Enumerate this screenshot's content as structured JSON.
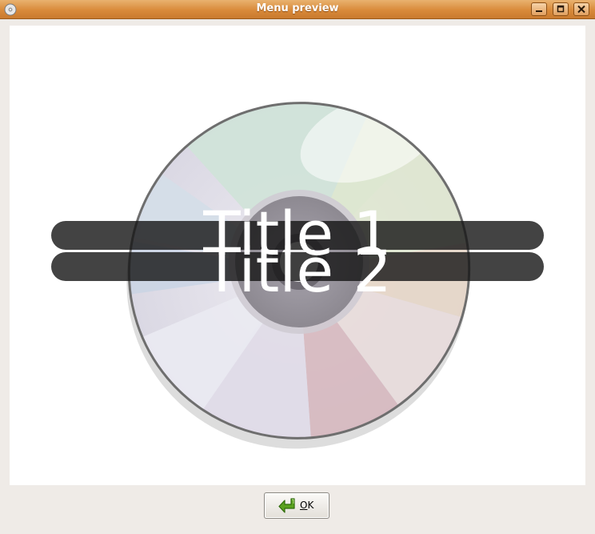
{
  "window": {
    "title": "Menu preview"
  },
  "preview": {
    "menu_items": [
      {
        "label": "Title 1"
      },
      {
        "label": "Title 2"
      }
    ],
    "background_image": "cd-disc-icon"
  },
  "footer": {
    "ok_button": {
      "mnemonic": "O",
      "rest": "K",
      "icon": "ok-return-arrow-icon"
    }
  },
  "colors": {
    "titlebar": "#d98a3a",
    "menu_bar": "#141414",
    "ok_icon": "#5aa21e"
  }
}
